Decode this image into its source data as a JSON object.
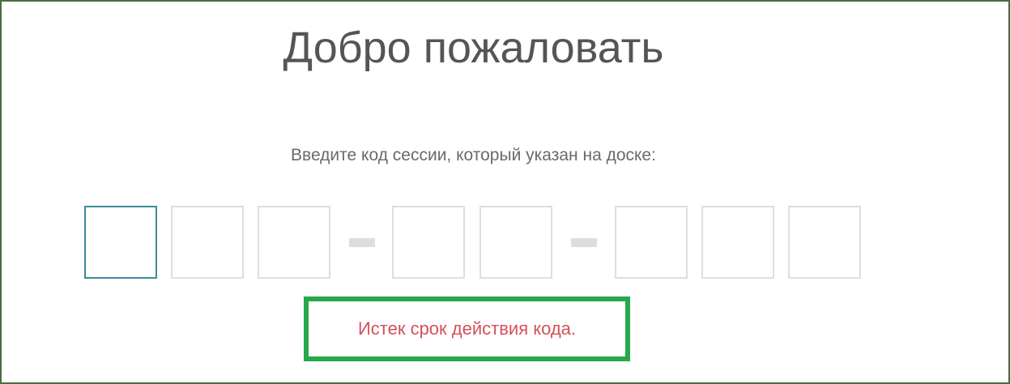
{
  "header": {
    "title": "Добро пожаловать"
  },
  "form": {
    "prompt": "Введите код сессии, который указан на доске:",
    "code_digits": [
      "",
      "",
      "",
      "",
      "",
      "",
      "",
      ""
    ],
    "separator": "-",
    "focused_index": 0
  },
  "error": {
    "message": "Истек срок действия кода."
  },
  "colors": {
    "frame_border": "#4a6b44",
    "focus_border": "#3d8a9c",
    "box_border": "#dedede",
    "error_text": "#d4505a",
    "highlight_border": "#27a84a"
  }
}
